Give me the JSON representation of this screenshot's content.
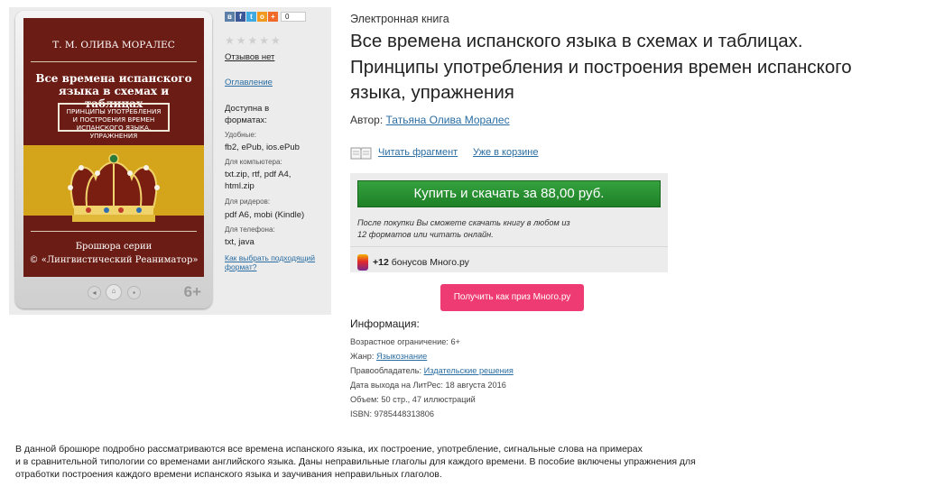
{
  "cover": {
    "author": "Т. М. ОЛИВА МОРАЛЕС",
    "title_line1": "Все времена испанского",
    "title_line2": "языка в схемах и таблицах",
    "subtitle_line1": "ПРИНЦИПЫ УПОТРЕБЛЕНИЯ",
    "subtitle_line2": "И ПОСТРОЕНИЯ ВРЕМЕН",
    "subtitle_line3": "ИСПАНСКОГО ЯЗЫКА, УПРАЖНЕНИЯ",
    "series_line1": "Брошюра серии",
    "series_line2": "© «Лингвистический Реаниматор»",
    "age": "6+"
  },
  "sidebar": {
    "share_count": "0",
    "reviews": "Отзывов нет",
    "toc": "Оглавление",
    "available_line1": "Доступна в",
    "available_line2": "форматах:",
    "groups": [
      {
        "label": "Удобные:",
        "formats_line1": "fb2, ePub, ios.ePub",
        "formats_line2": ""
      },
      {
        "label": "Для компьютера:",
        "formats_line1": "txt.zip, rtf, pdf A4,",
        "formats_line2": "html.zip"
      },
      {
        "label": "Для ридеров:",
        "formats_line1": "pdf A6, mobi (Kindle)",
        "formats_line2": ""
      },
      {
        "label": "Для телефона:",
        "formats_line1": "txt, java",
        "formats_line2": ""
      }
    ],
    "choose_line1": "Как выбрать подходящий",
    "choose_line2": "формат?"
  },
  "book": {
    "type": "Электронная книга",
    "title_line1": "Все времена испанского языка в схемах и таблицах.",
    "title_line2": "Принципы употребления и построения времен испанского",
    "title_line3": "языка, упражнения",
    "author_label": "Автор:",
    "author_name": "Татьяна Олива Моралес",
    "read_fragment": "Читать фрагмент",
    "in_cart": "Уже в корзине"
  },
  "buy": {
    "button": "Купить и скачать за 88,00 руб.",
    "note_line1": "После покупки Вы сможете скачать книгу в любом из",
    "note_line2": "12 форматов или читать онлайн.",
    "bonus_count": "+12",
    "bonus_text": " бонусов Много.ру",
    "prize_button": "Получить как приз Много.ру"
  },
  "info": {
    "heading": "Информация:",
    "age_label": "Возрастное ограничение:",
    "age_value": "6+",
    "genre_label": "Жанр:",
    "genre_value": "Языкознание",
    "rights_label": "Правообладатель:",
    "rights_value": "Издательские решения",
    "date_label": "Дата выхода на ЛитРес:",
    "date_value": "18 августа 2016",
    "volume_label": "Объем:",
    "volume_value": "50 стр., 47 иллюстраций",
    "isbn_label": "ISBN:",
    "isbn_value": "9785448313806"
  },
  "description": {
    "line1": "В данной брошюре подробно рассматриваются все времена испанского языка, их построение, употребление, сигнальные слова на примерах",
    "line2": "и в сравнительной типологии со временами английского языка. Даны неправильные глаголы для каждого времени. В пособие включены упражнения для",
    "line3": "отработки построения каждого времени испанского языка и заучивания неправильных глаголов."
  }
}
